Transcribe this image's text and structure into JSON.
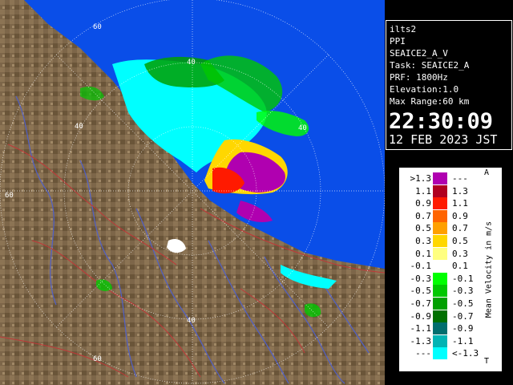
{
  "info": {
    "radar": "ilts2",
    "mode": "PPI",
    "product": "SEAICE2_A_V",
    "task": "Task: SEAICE2_A",
    "prf": "PRF: 1800Hz",
    "elevation": "Elevation:1.0",
    "max_range": "Max Range:60 km",
    "time": "22:30:09",
    "date": "12 FEB 2023 JST"
  },
  "legend": {
    "title": "Mean Velocity in m/s",
    "top_marker": "A",
    "bottom_marker": "T",
    "rows": [
      {
        "left": ">1.3",
        "right": "---",
        "color": "#b000b0"
      },
      {
        "left": "1.1",
        "right": "1.3",
        "color": "#b00020"
      },
      {
        "left": "0.9",
        "right": "1.1",
        "color": "#ff1a00"
      },
      {
        "left": "0.7",
        "right": "0.9",
        "color": "#ff6400"
      },
      {
        "left": "0.5",
        "right": "0.7",
        "color": "#ffa000"
      },
      {
        "left": "0.3",
        "right": "0.5",
        "color": "#ffd700"
      },
      {
        "left": "0.1",
        "right": "0.3",
        "color": "#ffff80"
      },
      {
        "left": "-0.1",
        "right": "0.1",
        "color": "#ffffff"
      },
      {
        "left": "-0.3",
        "right": "-0.1",
        "color": "#00ff00"
      },
      {
        "left": "-0.5",
        "right": "-0.3",
        "color": "#00c800"
      },
      {
        "left": "-0.7",
        "right": "-0.5",
        "color": "#00a000"
      },
      {
        "left": "-0.9",
        "right": "-0.7",
        "color": "#007000"
      },
      {
        "left": "-1.1",
        "right": "-0.9",
        "color": "#006e6e"
      },
      {
        "left": "-1.3",
        "right": "-1.1",
        "color": "#00b4b4"
      },
      {
        "left": "---",
        "right": "<-1.3",
        "color": "#00ffff"
      }
    ]
  },
  "map": {
    "range_labels": [
      "60",
      "40",
      "40",
      "40",
      "60",
      "40",
      "60"
    ],
    "colors": {
      "sea": "#0a4ee8",
      "land": "#7a6447",
      "river": "#5060c8",
      "road": "#b03030"
    }
  }
}
